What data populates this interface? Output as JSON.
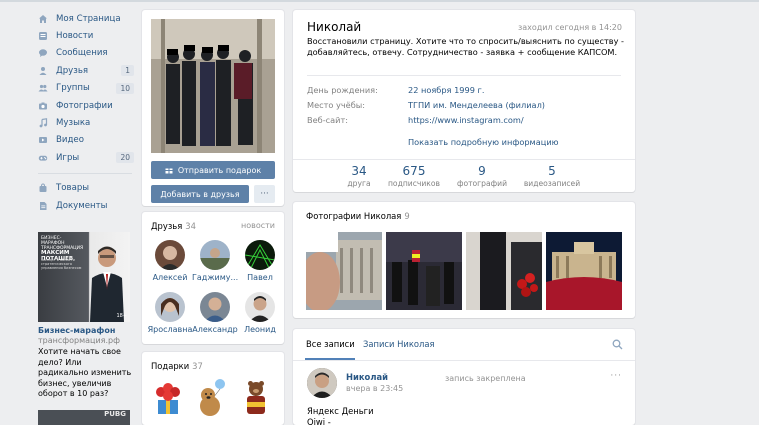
{
  "sidebar": {
    "items": [
      {
        "label": "Моя Страница",
        "icon": "home-icon",
        "count": ""
      },
      {
        "label": "Новости",
        "icon": "news-icon",
        "count": ""
      },
      {
        "label": "Сообщения",
        "icon": "messages-icon",
        "count": ""
      },
      {
        "label": "Друзья",
        "icon": "friends-icon",
        "count": "1"
      },
      {
        "label": "Группы",
        "icon": "groups-icon",
        "count": "10"
      },
      {
        "label": "Фотографии",
        "icon": "camera-icon",
        "count": ""
      },
      {
        "label": "Музыка",
        "icon": "music-icon",
        "count": ""
      },
      {
        "label": "Видео",
        "icon": "video-icon",
        "count": ""
      },
      {
        "label": "Игры",
        "icon": "gamepad-icon",
        "count": "20"
      }
    ],
    "items2": [
      {
        "label": "Товары",
        "icon": "bag-icon"
      },
      {
        "label": "Документы",
        "icon": "document-icon"
      }
    ]
  },
  "ad": {
    "brand": "БИЗНЕС-МАРАФОН ТРАНСФОРМАЦИЯ",
    "name": "МАКСИМ ПОТАШЕВ",
    "subtitle": "эксперт в области стратегического управления бизнесом",
    "age": "18+",
    "title": "Бизнес-марафон",
    "domain": "трансформация.рф",
    "text": "Хотите начать свое дело? Или радикально изменить бизнес, увеличив оборот в 10 раз?",
    "second_label": "PUBG"
  },
  "actions": {
    "gift_label": "Отправить подарок",
    "add_friend_label": "Добавить в друзья",
    "more_label": "···"
  },
  "friends": {
    "title": "Друзья",
    "count": "34",
    "news_link": "новости",
    "items": [
      {
        "name": "Алексей"
      },
      {
        "name": "Гаджиму..."
      },
      {
        "name": "Павел"
      },
      {
        "name": "Ярославна"
      },
      {
        "name": "Александр"
      },
      {
        "name": "Леонид"
      }
    ]
  },
  "gifts": {
    "title": "Подарки",
    "count": "37"
  },
  "profile": {
    "name": "Николай",
    "last_seen": "заходил сегодня в 14:20",
    "status": "Восстановили страницу. Хотите что то спросить/выяснить по существу - добавляйтесь, отвечу. Сотрудничество - заявка + сообщение КАПСОМ.",
    "rows": [
      {
        "key": "День рождения:",
        "value": "22 ноября 1999 г."
      },
      {
        "key": "Место учёбы:",
        "value": "ТГПИ им. Менделеева (филиал)"
      },
      {
        "key": "Веб-сайт:",
        "value": "https://www.instagram.com/"
      }
    ],
    "more_info": "Показать подробную информацию",
    "stats": [
      {
        "num": "34",
        "label": "друга"
      },
      {
        "num": "675",
        "label": "подписчиков"
      },
      {
        "num": "9",
        "label": "фотографий"
      },
      {
        "num": "5",
        "label": "видеозаписей"
      }
    ]
  },
  "photos": {
    "title": "Фотографии Николая",
    "count": "9"
  },
  "wall": {
    "tab_all": "Все записи",
    "tab_own": "Записи Николая",
    "post": {
      "author": "Николай",
      "date": "вчера в 23:45",
      "pinned": "запись закреплена",
      "more": "···",
      "text_line1": "Яндекс Деньги",
      "text_line2": "Qiwi -"
    }
  },
  "colors": {
    "link": "#2a5885",
    "button": "#5e81a8",
    "background": "#edeef0"
  }
}
